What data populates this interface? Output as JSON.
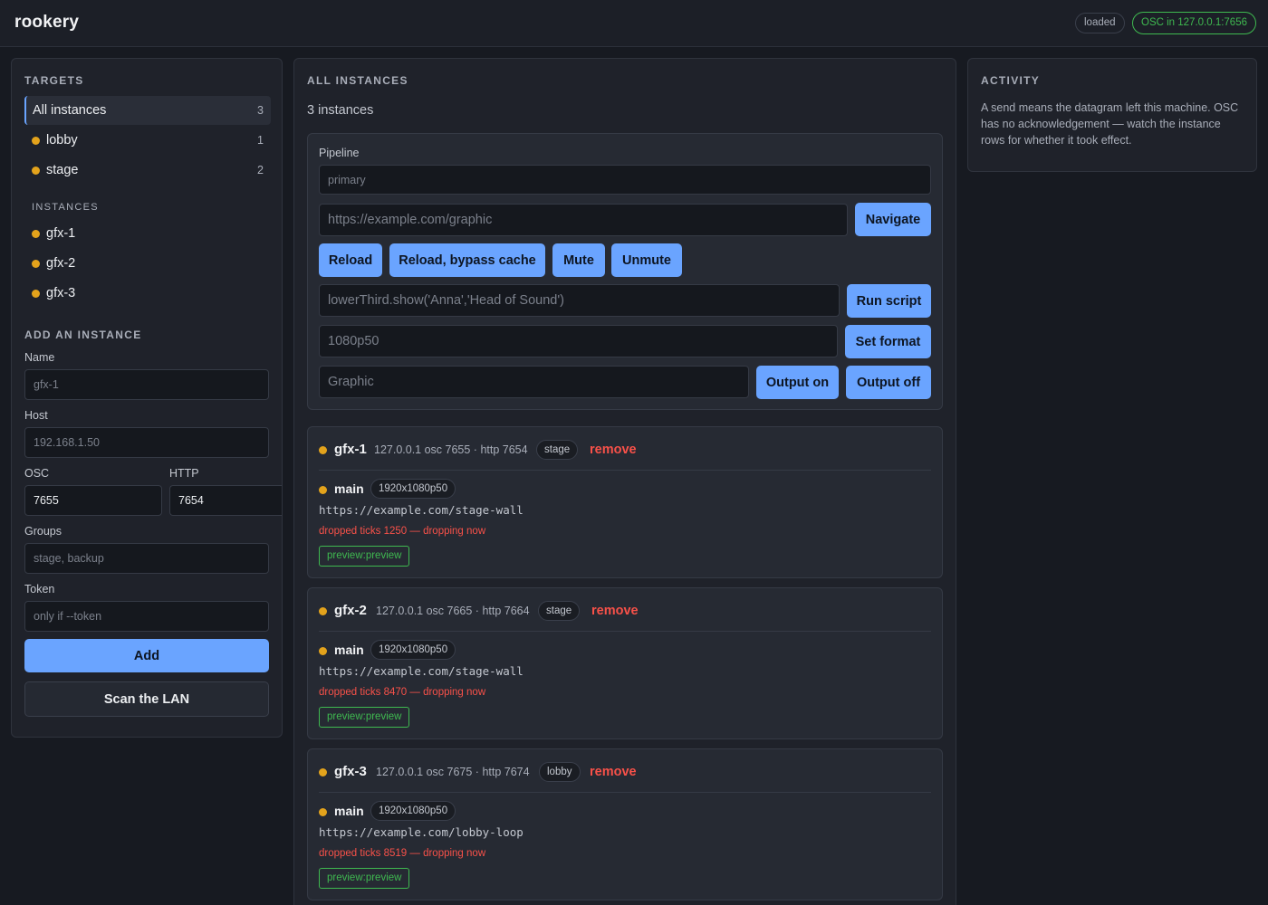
{
  "header": {
    "brand": "rookery",
    "status_loaded": "loaded",
    "status_osc": "OSC in 127.0.0.1:7656",
    "status_osc_color": "#3fb950"
  },
  "targets": {
    "title": "TARGETS",
    "all": {
      "label": "All instances",
      "count": "3"
    },
    "groups": [
      {
        "label": "lobby",
        "count": "1"
      },
      {
        "label": "stage",
        "count": "2"
      }
    ],
    "instances_title": "INSTANCES",
    "instances": [
      {
        "label": "gfx-1"
      },
      {
        "label": "gfx-2"
      },
      {
        "label": "gfx-3"
      }
    ],
    "status_dot_color": "#e3a31c"
  },
  "add_instance": {
    "title": "ADD AN INSTANCE",
    "name_label": "Name",
    "name_placeholder": "gfx-1",
    "host_label": "Host",
    "host_placeholder": "192.168.1.50",
    "osc_label": "OSC",
    "osc_value": "7655",
    "http_label": "HTTP",
    "http_value": "7654",
    "groups_label": "Groups",
    "groups_placeholder": "stage, backup",
    "token_label": "Token",
    "token_placeholder": "only if --token",
    "add_label": "Add",
    "scan_label": "Scan the LAN"
  },
  "main": {
    "title": "ALL INSTANCES",
    "count_text": "3 instances",
    "pipeline": {
      "label": "Pipeline",
      "pipeline_placeholder": "primary",
      "url_placeholder": "https://example.com/graphic",
      "navigate_label": "Navigate",
      "reload_label": "Reload",
      "reload_bypass_label": "Reload, bypass cache",
      "mute_label": "Mute",
      "unmute_label": "Unmute",
      "script_placeholder": "lowerThird.show('Anna','Head of Sound')",
      "run_script_label": "Run script",
      "format_placeholder": "1080p50",
      "set_format_label": "Set format",
      "output_placeholder": "Graphic",
      "output_on_label": "Output on",
      "output_off_label": "Output off"
    },
    "instances": [
      {
        "name": "gfx-1",
        "meta": "127.0.0.1 osc 7655 · http 7654",
        "group": "stage",
        "remove_label": "remove",
        "channel": {
          "name": "main",
          "format": "1920x1080p50",
          "url": "https://example.com/stage-wall",
          "warning": "dropped ticks 1250 — dropping now",
          "preview": "preview:preview"
        }
      },
      {
        "name": "gfx-2",
        "meta": "127.0.0.1 osc 7665 · http 7664",
        "group": "stage",
        "remove_label": "remove",
        "channel": {
          "name": "main",
          "format": "1920x1080p50",
          "url": "https://example.com/stage-wall",
          "warning": "dropped ticks 8470 — dropping now",
          "preview": "preview:preview"
        }
      },
      {
        "name": "gfx-3",
        "meta": "127.0.0.1 osc 7675 · http 7674",
        "group": "lobby",
        "remove_label": "remove",
        "channel": {
          "name": "main",
          "format": "1920x1080p50",
          "url": "https://example.com/lobby-loop",
          "warning": "dropped ticks 8519 — dropping now",
          "preview": "preview:preview"
        }
      }
    ]
  },
  "activity": {
    "title": "ACTIVITY",
    "text": "A send means the datagram left this machine. OSC has no acknowledgement — watch the instance rows for whether it took effect."
  },
  "colors": {
    "accent": "#6aa4ff",
    "danger": "#f85149",
    "success": "#3fb950",
    "warning_dot": "#e3a31c"
  }
}
